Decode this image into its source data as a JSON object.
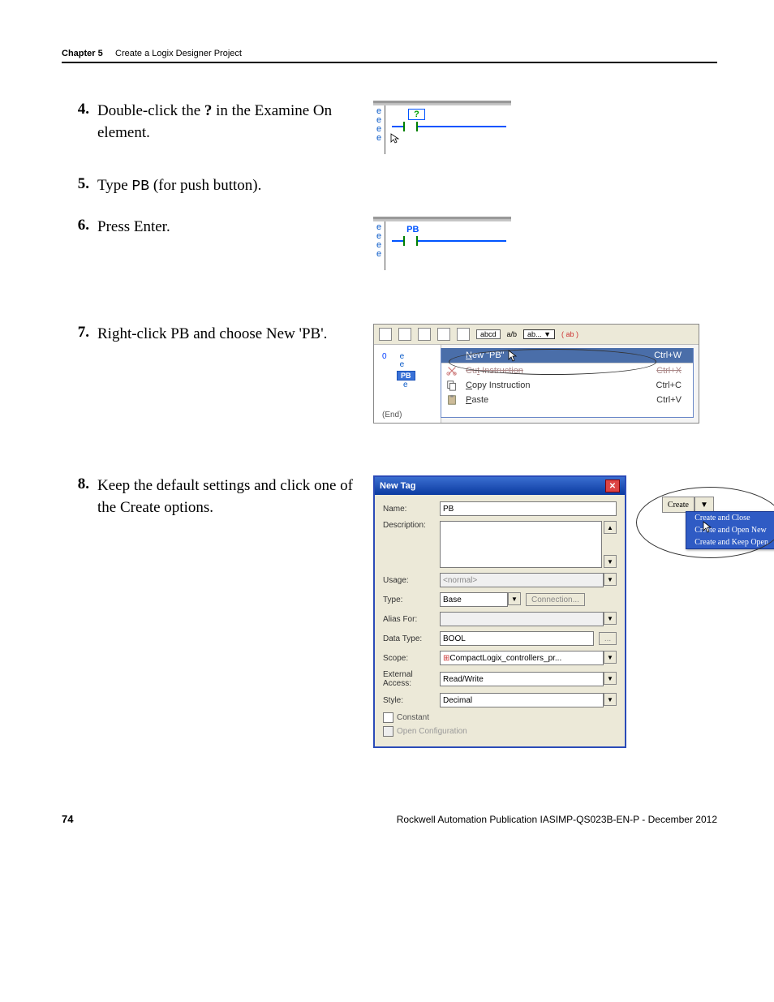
{
  "header": {
    "chapter": "Chapter 5",
    "title": "Create a Logix Designer Project"
  },
  "steps": {
    "s4": {
      "num": "4.",
      "pre": "Double-click the ",
      "bold": "?",
      "post": " in the Examine On element."
    },
    "s5": {
      "num": "5.",
      "pre": "Type ",
      "mono": "PB",
      "post": " (for push button)."
    },
    "s6": {
      "num": "6.",
      "text": "Press Enter."
    },
    "s7": {
      "num": "7.",
      "text": "Right-click PB and choose New 'PB'."
    },
    "s8": {
      "num": "8.",
      "text": "Keep the default settings and click one of the Create options."
    }
  },
  "fig1": {
    "e": "e",
    "qmark": "?"
  },
  "fig2": {
    "e": "e",
    "pb": "PB"
  },
  "ctx": {
    "rung0": "0",
    "e": "e",
    "pb": "PB",
    "end": "(End)",
    "tb_abcd": "abcd",
    "tb_ab": "ab...",
    "tb_red": "( ab )",
    "items": {
      "new_label": "New \"PB\"",
      "new_sc": "Ctrl+W",
      "cut_label": "Cut Instruction",
      "cut_sc": "Ctrl+X",
      "copy_label": "Copy Instruction",
      "copy_sc": "Ctrl+C",
      "paste_label": "Paste",
      "paste_sc": "Ctrl+V"
    }
  },
  "dlg": {
    "title": "New Tag",
    "labels": {
      "name": "Name:",
      "description": "Description:",
      "usage": "Usage:",
      "type": "Type:",
      "alias": "Alias For:",
      "datatype": "Data Type:",
      "scope": "Scope:",
      "external": "External Access:",
      "style": "Style:"
    },
    "values": {
      "name": "PB",
      "usage": "<normal>",
      "type": "Base",
      "connection_btn": "Connection...",
      "datatype": "BOOL",
      "dt_btn": "...",
      "scope": "CompactLogix_controllers_pr...",
      "external": "Read/Write",
      "style": "Decimal"
    },
    "checks": {
      "constant": "Constant",
      "opencfg": "Open Configuration"
    },
    "create_btn": "Create",
    "create_menu": {
      "a": "Create and Close",
      "b": "Create and Open New",
      "c": "Create and Keep Open"
    }
  },
  "footer": {
    "page": "74",
    "pub": "Rockwell Automation Publication IASIMP-QS023B-EN-P - December 2012"
  }
}
